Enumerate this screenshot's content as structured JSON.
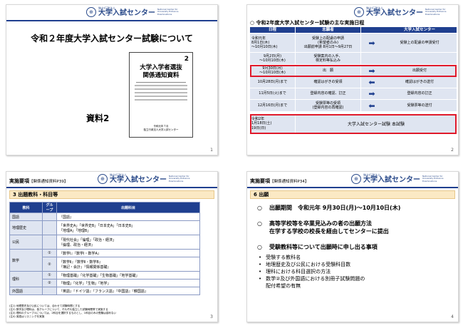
{
  "logo": {
    "seal": "⊕",
    "small": "独立行政法人",
    "main": "大学入試センター",
    "en": "National Center for University Entrance Examinations"
  },
  "slide1": {
    "title": "令和２年度大学入試センター試験について",
    "doc_number": "2",
    "doc_title_line1": "大学入学者選抜",
    "doc_title_line2": "関係通知資料",
    "doc_date": "令和元年７月",
    "doc_issuer": "独立行政法人大学入試センター",
    "label": "資料2",
    "page": "1"
  },
  "slide2": {
    "heading": "○ 令和2年度大学入試センター試験の主な実施日程",
    "columns": [
      "日程",
      "志願者",
      "",
      "大学入試センター"
    ],
    "rows": [
      {
        "date": "令和元年\n8月1日(木)\n～10月10日(木)",
        "applicant": "受験上の配慮の申請\n(希望者のみ)\n出願前申請 8月1日～9月27日",
        "arrow": "➡",
        "center": "受験上の配慮の申請受付"
      },
      {
        "date": "9月2日(月)\n～10月10日(木)",
        "applicant": "受験案内の入手、\n検定料等払込み",
        "arrow": "",
        "center": ""
      },
      {
        "date": "9月30日(月)\n～10月10日(木)",
        "applicant": "出　願",
        "arrow": "➡",
        "center": "出願受付"
      },
      {
        "date": "10月28日(月)まで",
        "applicant": "確認はがきの受領",
        "arrow": "⬅",
        "center": "確認はがきの送付"
      },
      {
        "date": "11月5日(火)まで",
        "applicant": "登録内容の確認、訂正",
        "arrow": "➡",
        "center": "登録内容の訂正"
      },
      {
        "date": "12月16日(月)まで",
        "applicant": "受験票等の受領\n(登録内容の再確認)",
        "arrow": "⬅",
        "center": "受験票等の送付"
      }
    ],
    "final": {
      "date": "令和2年\n1月18日(土)\n19日(日)",
      "text": "大学入試センター試験 本試験"
    },
    "page": "2"
  },
  "slide3": {
    "title": "実施要項",
    "title_ref": "【関係通知資料P39】",
    "section": "3 出題教科・科目等",
    "col_subject": "教科",
    "col_group": "グループ",
    "col_items": "出題科目",
    "rows": [
      {
        "subject": "国語",
        "group": "",
        "items": "『国語』"
      },
      {
        "subject": "地理歴史",
        "group": "",
        "items": "「世界史A」「世界史B」「日本史A」「日本史B」\n「地理A」「地理B」"
      },
      {
        "subject": "公民",
        "group": "",
        "items": "「現代社会」「倫理」「政治・経済」\n『倫理、政治・経済』"
      },
      {
        "subject": "数学",
        "group": "①",
        "items": "『数学Ⅰ』『数学Ⅰ・数学A』"
      },
      {
        "subject": "",
        "group": "②",
        "items": "『数学Ⅱ』『数学Ⅱ・数学B』\n『簿記・会計』『情報関係基礎』"
      },
      {
        "subject": "理科",
        "group": "①",
        "items": "「物理基礎」「化学基礎」「生物基礎」「地学基礎」"
      },
      {
        "subject": "",
        "group": "②",
        "items": "「物理」「化学」「生物」「地学」"
      },
      {
        "subject": "外国語",
        "group": "",
        "items": "『英語』『ドイツ語』『フランス語』『中国語』『韓国語』"
      }
    ],
    "notes": [
      "(注1) 地理歴史及び公民については、合わせて試験時間とする",
      "(注2) 数学及び理科は、各グループについて、それぞれ独立した試験時間帯で実施する",
      "(注3) 理科のグループ①については、2科目を選択するものとし、1科目のみの受験は認めない",
      "(注4) 英語はリスニングを実施"
    ],
    "page": "3"
  },
  "slide4": {
    "title": "実施要項",
    "title_ref": "【関係通知資料P34】",
    "section": "6 出願",
    "bullets_main": [
      {
        "mark": "○",
        "text": "出願期間　令和元年 9月30日(月)～10月10日(木)"
      },
      {
        "mark": "○",
        "text": "高等学校等を卒業見込みの者の出願方法\n在学する学校の校長を経由してセンターに提出"
      },
      {
        "mark": "○",
        "text": "受験教科等について出願時に申し出る事項"
      }
    ],
    "bullets_sub": [
      "受験する教科名",
      "地理歴史及び公民における受験科目数",
      "理科における科目選択の方法",
      "数学②及び外国語における別冊子試験問題の\n配付希望の有無"
    ],
    "page": "4"
  }
}
